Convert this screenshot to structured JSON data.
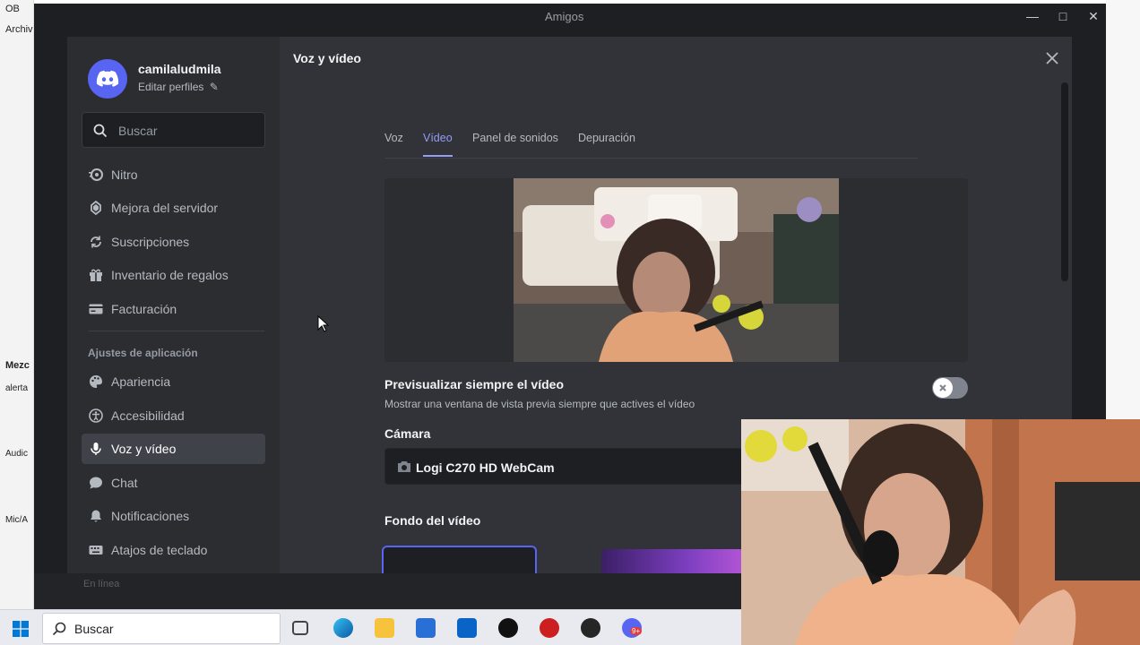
{
  "background": {
    "obs_labels": [
      "OB",
      "Archiv",
      "Mezc",
      "alerta",
      "Audic",
      "Mic/A"
    ]
  },
  "window": {
    "title": "Amigos"
  },
  "user": {
    "name": "camilaludmila",
    "edit_label": "Editar perfiles"
  },
  "search": {
    "placeholder": "Buscar"
  },
  "sidebar": {
    "items_top": [
      {
        "label": "Nitro",
        "icon": "nitro-icon"
      },
      {
        "label": "Mejora del servidor",
        "icon": "boost-icon"
      },
      {
        "label": "Suscripciones",
        "icon": "subscriptions-icon"
      },
      {
        "label": "Inventario de regalos",
        "icon": "gift-icon"
      },
      {
        "label": "Facturación",
        "icon": "billing-icon"
      }
    ],
    "section_header": "Ajustes de aplicación",
    "items_app": [
      {
        "label": "Apariencia",
        "icon": "palette-icon"
      },
      {
        "label": "Accesibilidad",
        "icon": "accessibility-icon"
      },
      {
        "label": "Voz y vídeo",
        "icon": "microphone-icon",
        "active": true
      },
      {
        "label": "Chat",
        "icon": "chat-bubble-icon"
      },
      {
        "label": "Notificaciones",
        "icon": "bell-icon"
      },
      {
        "label": "Atajos de teclado",
        "icon": "keyboard-icon"
      }
    ],
    "status": "En línea"
  },
  "content": {
    "title": "Voz y vídeo",
    "tabs": [
      {
        "label": "Voz",
        "active": false
      },
      {
        "label": "Vídeo",
        "active": true
      },
      {
        "label": "Panel de sonidos",
        "active": false
      },
      {
        "label": "Depuración",
        "active": false
      }
    ],
    "always_preview": {
      "title": "Previsualizar siempre el vídeo",
      "description": "Mostrar una ventana de vista previa siempre que actives el vídeo",
      "enabled": false
    },
    "camera": {
      "label": "Cámara",
      "selected": "Logi C270 HD WebCam"
    },
    "background_label": "Fondo del vídeo"
  },
  "taskbar": {
    "search_placeholder": "Buscar",
    "apps": [
      "task-view-icon",
      "edge-icon",
      "file-explorer-icon",
      "store-icon",
      "outlook-icon",
      "tiktok-icon",
      "record-app-icon",
      "obs-icon",
      "discord-icon"
    ],
    "discord_badge": "9+"
  },
  "colors": {
    "accent": "#949cf7",
    "brand": "#5865f2",
    "sidebar_bg": "#2b2d31",
    "content_bg": "#313338"
  }
}
